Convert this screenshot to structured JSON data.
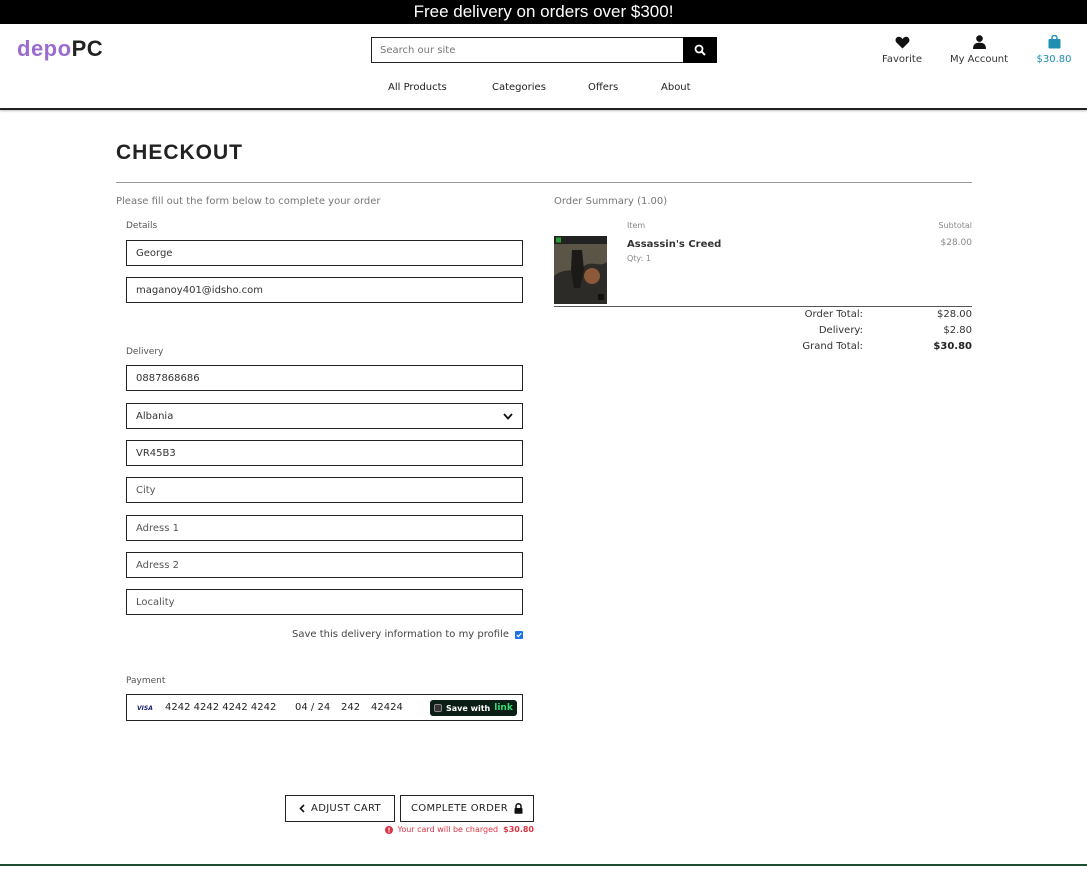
{
  "banner": {
    "text": "Free delivery on orders over $300!"
  },
  "header": {
    "logo_part1": "depo",
    "logo_part2": "PC",
    "search_placeholder": "Search our site",
    "favorite_label": "Favorite",
    "account_label": "My Account",
    "cart_total": "$30.80"
  },
  "nav": {
    "items": [
      "All Products",
      "Categories",
      "Offers",
      "About"
    ]
  },
  "page": {
    "title": "CHECKOUT"
  },
  "form": {
    "intro": "Please fill out the form below to complete your order",
    "details_label": "Details",
    "full_name": "George",
    "email": "maganoy401@idsho.com",
    "delivery_label": "Delivery",
    "phone": "0887868686",
    "country": "Albania",
    "postcode": "VR45B3",
    "city_placeholder": "City",
    "address1_placeholder": "Adress 1",
    "address2_placeholder": "Adress 2",
    "locality_placeholder": "Locality",
    "save_info_label": "Save this delivery information to my profile",
    "save_info_checked": true,
    "payment_label": "Payment",
    "card": {
      "brand": "VISA",
      "number": "4242 4242 4242 4242",
      "expiry": "04 / 24",
      "cvc": "242",
      "zip": "42424",
      "link_text": "Save with",
      "link_word": "link"
    }
  },
  "actions": {
    "adjust_cart": "ADJUST CART",
    "complete_order": "COMPLETE ORDER",
    "charge_notice": "Your card will be charged",
    "charge_amount": "$30.80"
  },
  "summary": {
    "title": "Order Summary (1.00)",
    "col_item": "Item",
    "col_subtotal": "Subtotal",
    "items": [
      {
        "name": "Assassin's Creed",
        "qty": "Qty: 1",
        "subtotal": "$28.00"
      }
    ],
    "order_total_label": "Order Total:",
    "order_total": "$28.00",
    "delivery_label": "Delivery:",
    "delivery": "$2.80",
    "grand_total_label": "Grand Total:",
    "grand_total": "$30.80"
  },
  "colors": {
    "logo_accent": "#9b6cd0",
    "cart_accent": "#1e8fb0",
    "error": "#dc3545",
    "footer_line": "#1f4d33"
  }
}
